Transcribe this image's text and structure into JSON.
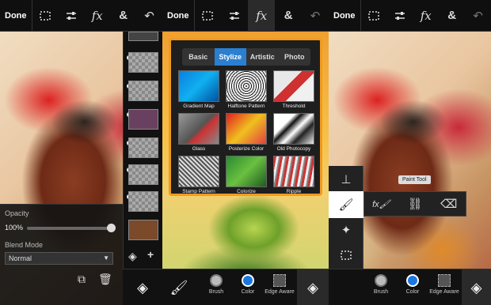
{
  "screens": [
    {
      "done": "Done"
    },
    {
      "done": "Done"
    },
    {
      "done": "Done"
    }
  ],
  "icons": {
    "toolbar": [
      "selection-icon",
      "adjust-icon",
      "fx-icon",
      "combine-icon",
      "undo-icon"
    ]
  },
  "toolbar": {
    "fx": "fx",
    "combine": "&",
    "undo": "↶"
  },
  "layers_panel": {
    "opacity_label": "Opacity",
    "opacity_value": "100%",
    "opacity_level": 1.0,
    "blend_label": "Blend Mode",
    "blend_value": "Normal"
  },
  "fx": {
    "tabs": [
      "Basic",
      "Stylize",
      "Artistic",
      "Photo"
    ],
    "selected_tab": "Stylize",
    "filters": [
      "Gradient Map",
      "Halftone Pattern",
      "Threshold",
      "Glass",
      "Posterize Color",
      "Old Photocopy",
      "Stamp Pattern",
      "Colorize",
      "Ripple"
    ]
  },
  "bottom_bar": {
    "brush": "Brush",
    "color": "Color",
    "edge": "Edge Aware"
  },
  "tooltip": {
    "paint": "Paint Tool"
  },
  "colors": {
    "accent": "#2a7fd0",
    "frame": "#f09a20"
  }
}
